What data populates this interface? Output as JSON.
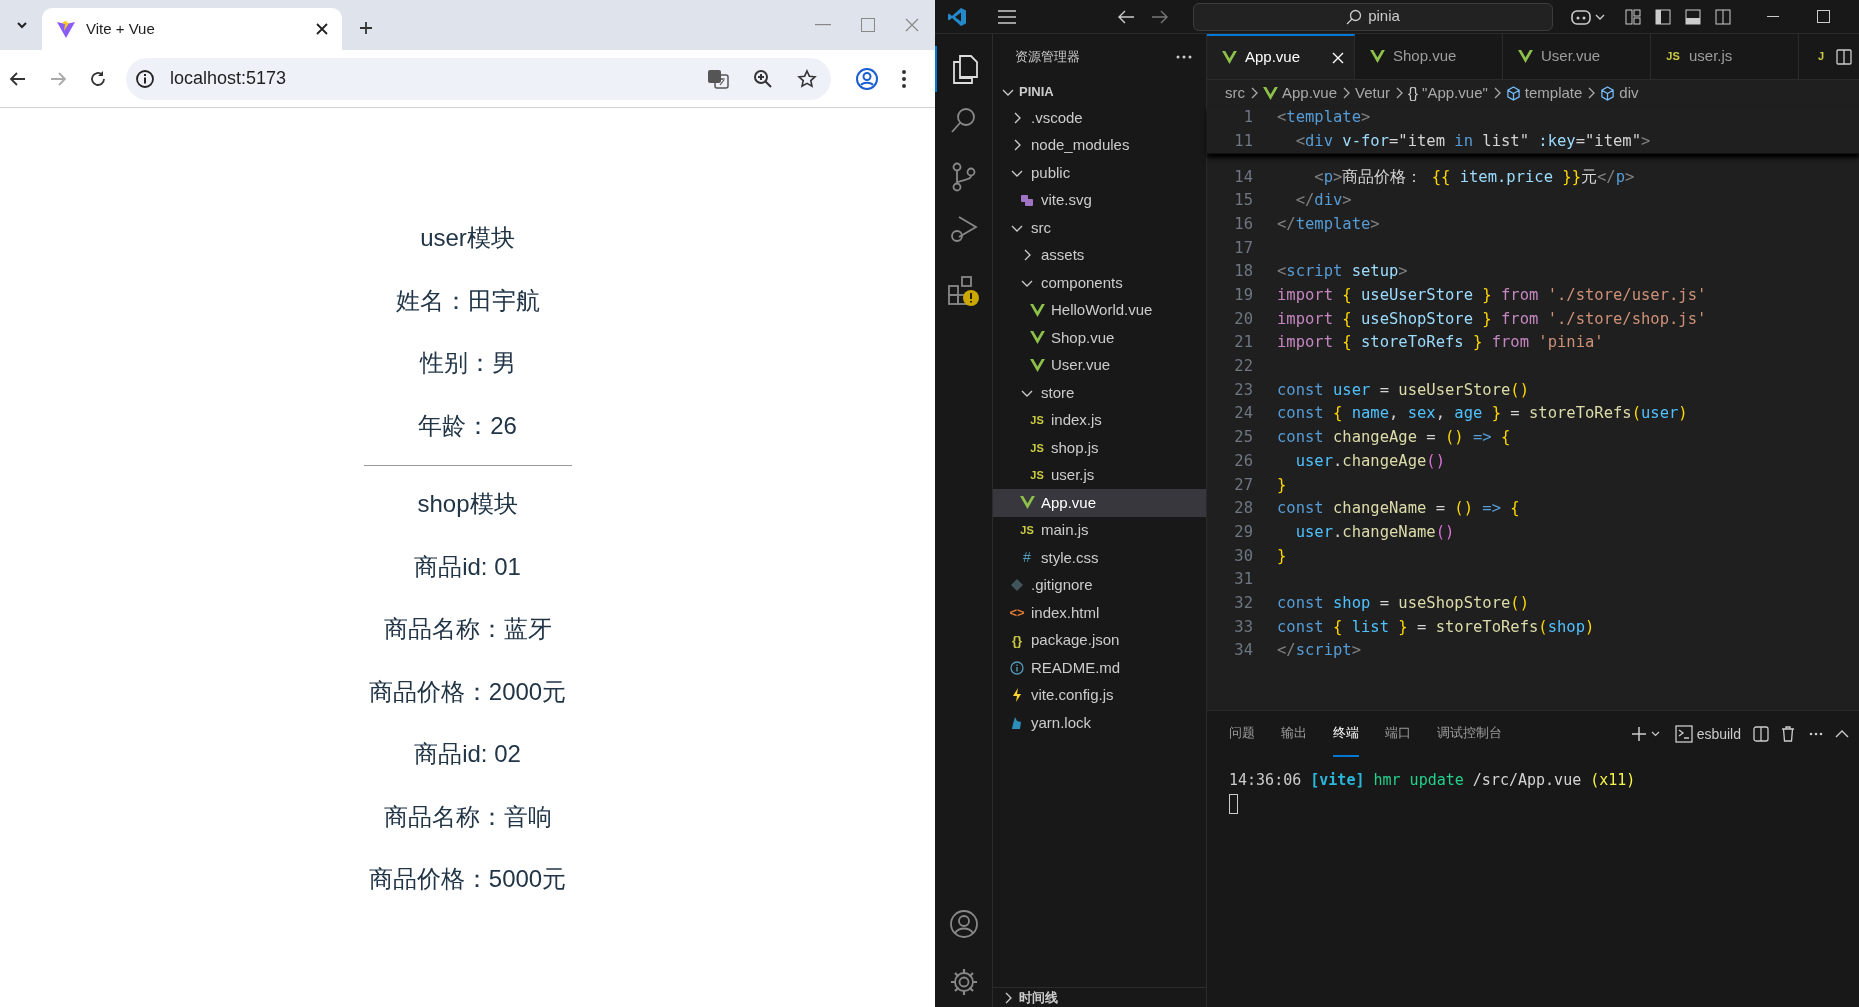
{
  "browser": {
    "tab": {
      "title": "Vite + Vue"
    },
    "address": "localhost:5173",
    "sections": [
      {
        "title": "user模块",
        "lines": [
          "姓名：田宇航",
          "性别：男",
          "年龄：26"
        ]
      },
      {
        "title": "shop模块",
        "lines": [
          "商品id: 01",
          "商品名称：蓝牙",
          "商品价格：2000元",
          "商品id: 02",
          "商品名称：音响",
          "商品价格：5000元"
        ]
      }
    ]
  },
  "vscode": {
    "search": "pinia",
    "explorer": {
      "title": "资源管理器",
      "root": "PINIA",
      "timeline": "时间线",
      "tree": [
        {
          "name": ".vscode",
          "kind": "folder",
          "expanded": false
        },
        {
          "name": "node_modules",
          "kind": "folder",
          "expanded": false
        },
        {
          "name": "public",
          "kind": "folder",
          "expanded": true,
          "children": [
            {
              "name": "vite.svg",
              "kind": "svg",
              "selected": false
            }
          ]
        },
        {
          "name": "src",
          "kind": "folder",
          "expanded": true,
          "children": [
            {
              "name": "assets",
              "kind": "folder",
              "expanded": false
            },
            {
              "name": "components",
              "kind": "folder",
              "expanded": true,
              "children": [
                {
                  "name": "HelloWorld.vue",
                  "kind": "vue",
                  "selected": false
                },
                {
                  "name": "Shop.vue",
                  "kind": "vue",
                  "selected": false
                },
                {
                  "name": "User.vue",
                  "kind": "vue",
                  "selected": false
                }
              ]
            },
            {
              "name": "store",
              "kind": "folder",
              "expanded": true,
              "children": [
                {
                  "name": "index.js",
                  "kind": "js",
                  "glyph": "JS",
                  "selected": false
                },
                {
                  "name": "shop.js",
                  "kind": "js",
                  "glyph": "JS",
                  "selected": false
                },
                {
                  "name": "user.js",
                  "kind": "js",
                  "glyph": "JS",
                  "selected": false
                }
              ]
            },
            {
              "name": "App.vue",
              "kind": "vue",
              "selected": true
            },
            {
              "name": "main.js",
              "kind": "js",
              "glyph": "JS",
              "selected": false
            },
            {
              "name": "style.css",
              "kind": "css",
              "glyph": "#",
              "selected": false
            }
          ]
        },
        {
          "name": ".gitignore",
          "kind": "git",
          "selected": false
        },
        {
          "name": "index.html",
          "kind": "html",
          "glyph": "<>",
          "selected": false
        },
        {
          "name": "package.json",
          "kind": "json",
          "glyph": "{}",
          "selected": false
        },
        {
          "name": "README.md",
          "kind": "info",
          "selected": false
        },
        {
          "name": "vite.config.js",
          "kind": "vite",
          "selected": false
        },
        {
          "name": "yarn.lock",
          "kind": "yarn",
          "selected": false
        }
      ]
    },
    "tabs": [
      {
        "name": "App.vue",
        "kind": "vue",
        "selected": true
      },
      {
        "name": "Shop.vue",
        "kind": "vue",
        "selected": false
      },
      {
        "name": "User.vue",
        "kind": "vue",
        "selected": false
      },
      {
        "name": "user.js",
        "kind": "js",
        "glyph": "JS",
        "selected": false
      },
      {
        "kind": "js",
        "glyph": "J",
        "selected": false
      }
    ],
    "breadcrumbs": [
      {
        "label": "src",
        "kind": "plain"
      },
      {
        "label": "App.vue",
        "kind": "vue"
      },
      {
        "label": "Vetur",
        "kind": "plain"
      },
      {
        "label": "\"App.vue\"",
        "kind": "braces",
        "glyph": "{}"
      },
      {
        "label": "template",
        "kind": "element"
      },
      {
        "label": "div",
        "kind": "element"
      }
    ],
    "sticky_lines": [
      {
        "number": "1",
        "tokens": [
          {
            "kind": "p",
            "text": "<"
          },
          {
            "kind": "tag",
            "text": "template"
          },
          {
            "kind": "p",
            "text": ">"
          }
        ]
      },
      {
        "number": "11",
        "tokens": [
          {
            "kind": "p",
            "text": "  <"
          },
          {
            "kind": "tag",
            "text": "div "
          },
          {
            "kind": "attr",
            "text": "v-for"
          },
          {
            "kind": "txt",
            "text": "=\"item "
          },
          {
            "kind": "storage",
            "text": "in"
          },
          {
            "kind": "txt",
            "text": " list\" "
          },
          {
            "kind": "attr",
            "text": ":key"
          },
          {
            "kind": "txt",
            "text": "=\"item\""
          },
          {
            "kind": "p",
            "text": ">"
          }
        ]
      }
    ],
    "lines": [
      {
        "number": "14",
        "tokens": [
          {
            "kind": "p",
            "text": "    <"
          },
          {
            "kind": "tag",
            "text": "p"
          },
          {
            "kind": "p",
            "text": ">"
          },
          {
            "kind": "txt",
            "text": "商品价格： "
          },
          {
            "kind": "b1",
            "text": "{{ "
          },
          {
            "kind": "var",
            "text": "item.price"
          },
          {
            "kind": "b1",
            "text": " }}"
          },
          {
            "kind": "txt",
            "text": "元"
          },
          {
            "kind": "p",
            "text": "</"
          },
          {
            "kind": "tag",
            "text": "p"
          },
          {
            "kind": "p",
            "text": ">"
          }
        ]
      },
      {
        "number": "15",
        "tokens": [
          {
            "kind": "p",
            "text": "  </"
          },
          {
            "kind": "tag",
            "text": "div"
          },
          {
            "kind": "p",
            "text": ">"
          }
        ]
      },
      {
        "number": "16",
        "tokens": [
          {
            "kind": "p",
            "text": "</"
          },
          {
            "kind": "tag",
            "text": "template"
          },
          {
            "kind": "p",
            "text": ">"
          }
        ]
      },
      {
        "number": "17"
      },
      {
        "number": "18",
        "tokens": [
          {
            "kind": "p",
            "text": "<"
          },
          {
            "kind": "tag",
            "text": "script "
          },
          {
            "kind": "attr",
            "text": "setup"
          },
          {
            "kind": "p",
            "text": ">"
          }
        ]
      },
      {
        "number": "19",
        "tokens": [
          {
            "kind": "kw",
            "text": "import "
          },
          {
            "kind": "b1",
            "text": "{ "
          },
          {
            "kind": "var",
            "text": "useUserStore"
          },
          {
            "kind": "b1",
            "text": " } "
          },
          {
            "kind": "kw",
            "text": "from "
          },
          {
            "kind": "str",
            "text": "'./store/user.js'"
          }
        ]
      },
      {
        "number": "20",
        "tokens": [
          {
            "kind": "kw",
            "text": "import "
          },
          {
            "kind": "b1",
            "text": "{ "
          },
          {
            "kind": "var",
            "text": "useShopStore"
          },
          {
            "kind": "b1",
            "text": " } "
          },
          {
            "kind": "kw",
            "text": "from "
          },
          {
            "kind": "str",
            "text": "'./store/shop.js'"
          }
        ]
      },
      {
        "number": "21",
        "tokens": [
          {
            "kind": "kw",
            "text": "import "
          },
          {
            "kind": "b1",
            "text": "{ "
          },
          {
            "kind": "var",
            "text": "storeToRefs"
          },
          {
            "kind": "b1",
            "text": " } "
          },
          {
            "kind": "kw",
            "text": "from "
          },
          {
            "kind": "str",
            "text": "'pinia'"
          }
        ]
      },
      {
        "number": "22"
      },
      {
        "number": "23",
        "tokens": [
          {
            "kind": "storage",
            "text": "const "
          },
          {
            "kind": "const",
            "text": "user"
          },
          {
            "kind": "txt",
            "text": " = "
          },
          {
            "kind": "fn",
            "text": "useUserStore"
          },
          {
            "kind": "b1",
            "text": "()"
          }
        ]
      },
      {
        "number": "24",
        "tokens": [
          {
            "kind": "storage",
            "text": "const "
          },
          {
            "kind": "b1",
            "text": "{ "
          },
          {
            "kind": "const",
            "text": "name"
          },
          {
            "kind": "txt",
            "text": ", "
          },
          {
            "kind": "const",
            "text": "sex"
          },
          {
            "kind": "txt",
            "text": ", "
          },
          {
            "kind": "const",
            "text": "age"
          },
          {
            "kind": "b1",
            "text": " }"
          },
          {
            "kind": "txt",
            "text": " = "
          },
          {
            "kind": "fn",
            "text": "storeToRefs"
          },
          {
            "kind": "b1",
            "text": "("
          },
          {
            "kind": "const",
            "text": "user"
          },
          {
            "kind": "b1",
            "text": ")"
          }
        ]
      },
      {
        "number": "25",
        "tokens": [
          {
            "kind": "storage",
            "text": "const "
          },
          {
            "kind": "fn",
            "text": "changeAge"
          },
          {
            "kind": "txt",
            "text": " = "
          },
          {
            "kind": "b1",
            "text": "() "
          },
          {
            "kind": "storage",
            "text": "=>"
          },
          {
            "kind": "b1",
            "text": " {"
          }
        ]
      },
      {
        "number": "26",
        "tokens": [
          {
            "kind": "const",
            "text": "  user"
          },
          {
            "kind": "txt",
            "text": "."
          },
          {
            "kind": "fn",
            "text": "changeAge"
          },
          {
            "kind": "b2",
            "text": "()"
          }
        ]
      },
      {
        "number": "27",
        "tokens": [
          {
            "kind": "b1",
            "text": "}"
          }
        ]
      },
      {
        "number": "28",
        "tokens": [
          {
            "kind": "storage",
            "text": "const "
          },
          {
            "kind": "fn",
            "text": "changeName"
          },
          {
            "kind": "txt",
            "text": " = "
          },
          {
            "kind": "b1",
            "text": "() "
          },
          {
            "kind": "storage",
            "text": "=>"
          },
          {
            "kind": "b1",
            "text": " {"
          }
        ]
      },
      {
        "number": "29",
        "tokens": [
          {
            "kind": "const",
            "text": "  user"
          },
          {
            "kind": "txt",
            "text": "."
          },
          {
            "kind": "fn",
            "text": "changeName"
          },
          {
            "kind": "b2",
            "text": "()"
          }
        ]
      },
      {
        "number": "30",
        "tokens": [
          {
            "kind": "b1",
            "text": "}"
          }
        ]
      },
      {
        "number": "31"
      },
      {
        "number": "32",
        "tokens": [
          {
            "kind": "storage",
            "text": "const "
          },
          {
            "kind": "const",
            "text": "shop"
          },
          {
            "kind": "txt",
            "text": " = "
          },
          {
            "kind": "fn",
            "text": "useShopStore"
          },
          {
            "kind": "b1",
            "text": "()"
          }
        ]
      },
      {
        "number": "33",
        "tokens": [
          {
            "kind": "storage",
            "text": "const "
          },
          {
            "kind": "b1",
            "text": "{ "
          },
          {
            "kind": "const",
            "text": "list"
          },
          {
            "kind": "b1",
            "text": " }"
          },
          {
            "kind": "txt",
            "text": " = "
          },
          {
            "kind": "fn",
            "text": "storeToRefs"
          },
          {
            "kind": "b1",
            "text": "("
          },
          {
            "kind": "const",
            "text": "shop"
          },
          {
            "kind": "b1",
            "text": ")"
          }
        ]
      },
      {
        "number": "34",
        "tokens": [
          {
            "kind": "p",
            "text": "</"
          },
          {
            "kind": "tag",
            "text": "script"
          },
          {
            "kind": "p",
            "text": ">"
          }
        ]
      }
    ],
    "panel": {
      "tabs": [
        {
          "label": "问题",
          "selected": false
        },
        {
          "label": "输出",
          "selected": false
        },
        {
          "label": "终端",
          "selected": true
        },
        {
          "label": "端口",
          "selected": false
        },
        {
          "label": "调试控制台",
          "selected": false
        }
      ],
      "profile": "esbuild",
      "output": [
        {
          "kind": "time",
          "text": "14:36:06"
        },
        {
          "kind": "vite",
          "text": "[vite]"
        },
        {
          "kind": "green",
          "text": "hmr update"
        },
        {
          "kind": "txt",
          "text": "/src/App.vue"
        },
        {
          "kind": "yellow",
          "text": "(x11)"
        }
      ]
    }
  }
}
